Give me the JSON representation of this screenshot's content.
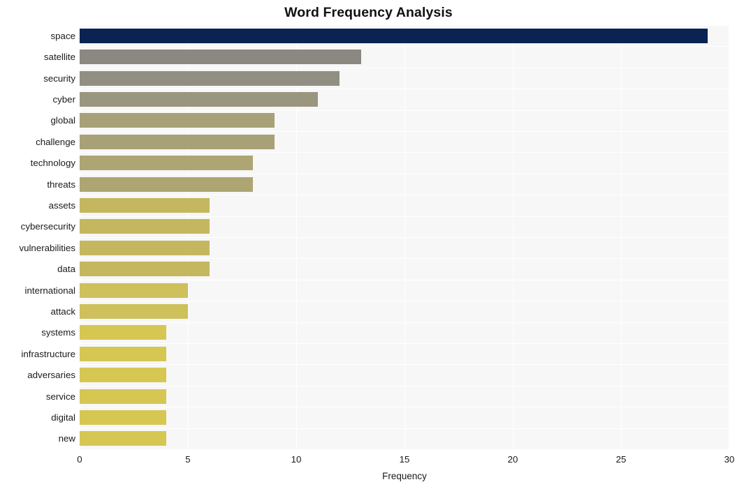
{
  "chart_data": {
    "type": "bar",
    "orientation": "horizontal",
    "title": "Word Frequency Analysis",
    "xlabel": "Frequency",
    "ylabel": "",
    "xlim": [
      0,
      30
    ],
    "xticks": [
      0,
      5,
      10,
      15,
      20,
      25,
      30
    ],
    "xtick_labels": [
      "0",
      "5",
      "10",
      "15",
      "20",
      "25",
      "30"
    ],
    "grid": true,
    "grid_color": "#ffffff",
    "plot_background": "#f7f7f7",
    "figure_background": "#ffffff",
    "legend": null,
    "categories": [
      "space",
      "satellite",
      "security",
      "cyber",
      "global",
      "challenge",
      "technology",
      "threats",
      "assets",
      "cybersecurity",
      "vulnerabilities",
      "data",
      "international",
      "attack",
      "systems",
      "infrastructure",
      "adversaries",
      "service",
      "digital",
      "new"
    ],
    "values": [
      29,
      13,
      12,
      11,
      9,
      9,
      8,
      8,
      6,
      6,
      6,
      6,
      5,
      5,
      4,
      4,
      4,
      4,
      4,
      4
    ],
    "bar_colors": [
      "#0a2352",
      "#8a8881",
      "#918e83",
      "#9a957f",
      "#a8a077",
      "#a8a077",
      "#ada572",
      "#ada572",
      "#c4b75f",
      "#c4b75f",
      "#c4b75f",
      "#c4b75f",
      "#cec05a",
      "#cec05a",
      "#d6c753",
      "#d6c753",
      "#d6c753",
      "#d6c753",
      "#d6c753",
      "#d6c753"
    ]
  }
}
